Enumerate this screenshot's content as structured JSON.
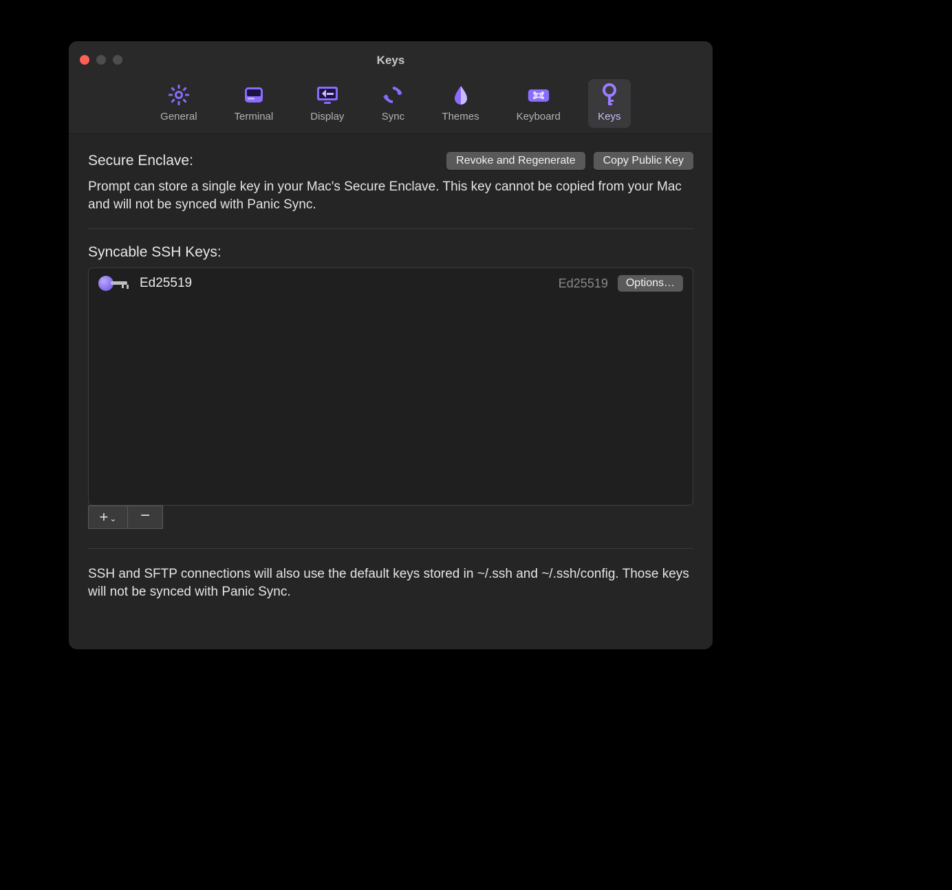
{
  "window": {
    "title": "Keys"
  },
  "colors": {
    "accent": "#8a6cff",
    "accent_light": "#b9a8ff"
  },
  "tabs": [
    {
      "id": "general",
      "label": "General",
      "icon": "gear-icon",
      "active": false
    },
    {
      "id": "terminal",
      "label": "Terminal",
      "icon": "terminal-icon",
      "active": false
    },
    {
      "id": "display",
      "label": "Display",
      "icon": "display-icon",
      "active": false
    },
    {
      "id": "sync",
      "label": "Sync",
      "icon": "sync-icon",
      "active": false
    },
    {
      "id": "themes",
      "label": "Themes",
      "icon": "themes-icon",
      "active": false
    },
    {
      "id": "keyboard",
      "label": "Keyboard",
      "icon": "keyboard-icon",
      "active": false
    },
    {
      "id": "keys",
      "label": "Keys",
      "icon": "keys-icon",
      "active": true
    }
  ],
  "secure_enclave": {
    "title": "Secure Enclave:",
    "revoke_label": "Revoke and Regenerate",
    "copy_label": "Copy Public Key",
    "description": "Prompt can store a single key in your Mac's Secure Enclave. This key cannot be copied from your Mac and will not be synced with Panic Sync."
  },
  "syncable": {
    "title": "Syncable SSH Keys:",
    "keys": [
      {
        "name": "Ed25519",
        "type": "Ed25519",
        "options_label": "Options…"
      }
    ],
    "add_label": "+",
    "add_menu_indicator": "⌄",
    "remove_label": "−"
  },
  "footer": {
    "note": "SSH and SFTP connections will also use the default keys stored in ~/.ssh and ~/.ssh/config. Those keys will not be synced with Panic Sync."
  }
}
